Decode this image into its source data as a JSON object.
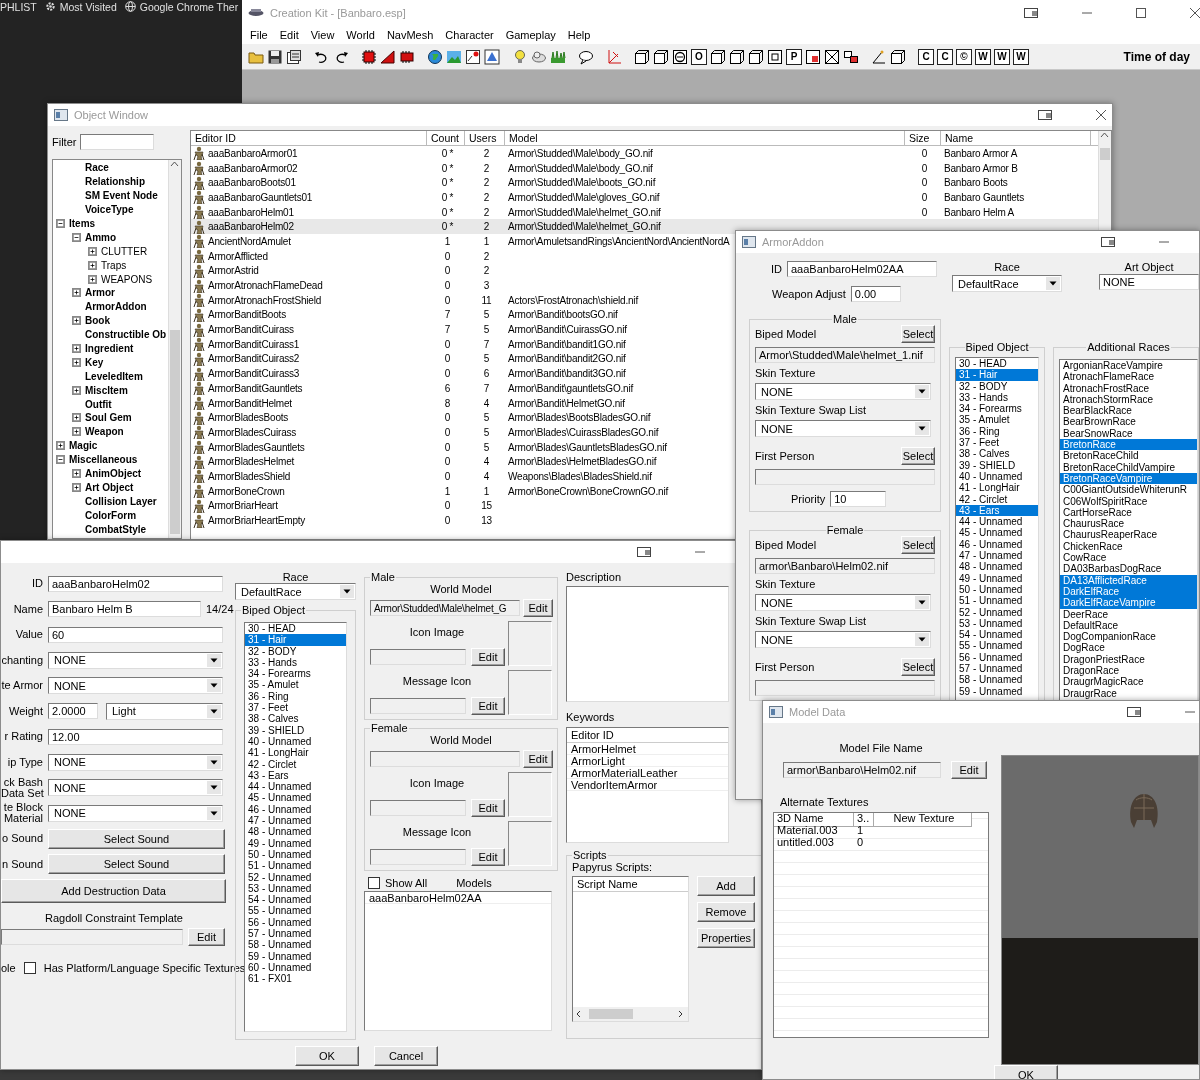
{
  "browser_bar": {
    "items": [
      {
        "label": "PHLIST",
        "kind": "plain"
      },
      {
        "label": "Most Visited",
        "kind": "gear"
      },
      {
        "label": "Google Chrome Ther",
        "kind": "globe"
      }
    ]
  },
  "main_window": {
    "title": "Creation Kit - [Banbaro.esp]",
    "menu": [
      "File",
      "Edit",
      "View",
      "World",
      "NavMesh",
      "Character",
      "Gameplay",
      "Help"
    ],
    "toolbar_glyphs": [
      "O",
      "P",
      "C",
      "C",
      "©",
      "W",
      "W",
      "W"
    ],
    "time_of_day": "Time of day"
  },
  "object_window": {
    "title": "Object Window",
    "filter_label": "Filter",
    "tree_continued": [
      {
        "label": "Race"
      },
      {
        "label": "Relationship"
      },
      {
        "label": "SM Event Node"
      },
      {
        "label": "VoiceType"
      }
    ],
    "tree": [
      {
        "label": "Items",
        "expandable": true,
        "expanded": true,
        "children": [
          {
            "label": "Ammo",
            "expandable": true,
            "expanded": true,
            "children": [
              {
                "label": "CLUTTER",
                "expandable": true,
                "expanded": false
              },
              {
                "label": "Traps",
                "expandable": true,
                "expanded": false
              },
              {
                "label": "WEAPONS",
                "expandable": true,
                "expanded": false
              }
            ]
          },
          {
            "label": "Armor",
            "expandable": true,
            "expanded": false
          },
          {
            "label": "ArmorAddon",
            "expandable": false,
            "expanded": false
          },
          {
            "label": "Book",
            "expandable": true,
            "expanded": false
          },
          {
            "label": "Constructible Ob",
            "expandable": false,
            "expanded": false
          },
          {
            "label": "Ingredient",
            "expandable": true,
            "expanded": false
          },
          {
            "label": "Key",
            "expandable": true,
            "expanded": false
          },
          {
            "label": "LeveledItem",
            "expandable": false,
            "expanded": false
          },
          {
            "label": "MiscItem",
            "expandable": true,
            "expanded": false
          },
          {
            "label": "Outfit",
            "expandable": false,
            "expanded": false
          },
          {
            "label": "Soul Gem",
            "expandable": true,
            "expanded": false
          },
          {
            "label": "Weapon",
            "expandable": true,
            "expanded": false
          }
        ]
      },
      {
        "label": "Magic",
        "expandable": true,
        "expanded": false
      },
      {
        "label": "Miscellaneous",
        "expandable": true,
        "expanded": true,
        "children": [
          {
            "label": "AnimObject",
            "expandable": true,
            "expanded": false
          },
          {
            "label": "Art Object",
            "expandable": true,
            "expanded": false
          },
          {
            "label": "Collision Layer",
            "expandable": false,
            "expanded": false
          },
          {
            "label": "ColorForm",
            "expandable": false,
            "expanded": false
          },
          {
            "label": "CombatStyle",
            "expandable": false,
            "expanded": false
          }
        ]
      }
    ],
    "table": {
      "columns": [
        "Editor ID",
        "Count",
        "Users",
        "Model",
        "Size",
        "Name"
      ],
      "rows": [
        {
          "editor_id": "aaaBanbaroArmor01",
          "count": "0 *",
          "users": "2",
          "model": "Armor\\Studded\\Male\\body_GO.nif",
          "size": "0",
          "name": "Banbaro Armor A",
          "selected": false
        },
        {
          "editor_id": "aaaBanbaroArmor02",
          "count": "0 *",
          "users": "2",
          "model": "Armor\\Studded\\Male\\body_GO.nif",
          "size": "0",
          "name": "Banbaro Armor B",
          "selected": false
        },
        {
          "editor_id": "aaaBanbaroBoots01",
          "count": "0 *",
          "users": "2",
          "model": "Armor\\Studded\\Male\\boots_GO.nif",
          "size": "0",
          "name": "Banbaro Boots",
          "selected": false
        },
        {
          "editor_id": "aaaBanbaroGauntlets01",
          "count": "0 *",
          "users": "2",
          "model": "Armor\\Studded\\Male\\gloves_GO.nif",
          "size": "0",
          "name": "Banbaro Gauntlets",
          "selected": false
        },
        {
          "editor_id": "aaaBanbaroHelm01",
          "count": "0 *",
          "users": "2",
          "model": "Armor\\Studded\\Male\\helmet_GO.nif",
          "size": "0",
          "name": "Banbaro Helm A",
          "selected": false
        },
        {
          "editor_id": "aaaBanbaroHelm02",
          "count": "0 *",
          "users": "2",
          "model": "Armor\\Studded\\Male\\helmet_GO.nif",
          "selected": true
        },
        {
          "editor_id": "AncientNordAmulet",
          "count": "1",
          "users": "1",
          "model": "Armor\\AmuletsandRings\\AncientNord\\AncientNordA",
          "selected": false
        },
        {
          "editor_id": "ArmorAfflicted",
          "count": "0",
          "users": "2",
          "selected": false
        },
        {
          "editor_id": "ArmorAstrid",
          "count": "0",
          "users": "2",
          "selected": false
        },
        {
          "editor_id": "ArmorAtronachFlameDead",
          "count": "0",
          "users": "3",
          "selected": false
        },
        {
          "editor_id": "ArmorAtronachFrostShield",
          "count": "0",
          "users": "11",
          "model": "Actors\\FrostAtronach\\shield.nif",
          "selected": false
        },
        {
          "editor_id": "ArmorBanditBoots",
          "count": "7",
          "users": "5",
          "model": "Armor\\Bandit\\bootsGO.nif",
          "selected": false
        },
        {
          "editor_id": "ArmorBanditCuirass",
          "count": "7",
          "users": "5",
          "model": "Armor\\Bandit\\CuirassGO.nif",
          "selected": false
        },
        {
          "editor_id": "ArmorBanditCuirass1",
          "count": "0",
          "users": "7",
          "model": "Armor\\Bandit\\bandit1GO.nif",
          "selected": false
        },
        {
          "editor_id": "ArmorBanditCuirass2",
          "count": "0",
          "users": "5",
          "model": "Armor\\Bandit\\bandit2GO.nif",
          "selected": false
        },
        {
          "editor_id": "ArmorBanditCuirass3",
          "count": "0",
          "users": "6",
          "model": "Armor\\Bandit\\bandit3GO.nif",
          "selected": false
        },
        {
          "editor_id": "ArmorBanditGauntlets",
          "count": "6",
          "users": "7",
          "model": "Armor\\Bandit\\gauntletsGO.nif",
          "selected": false
        },
        {
          "editor_id": "ArmorBanditHelmet",
          "count": "8",
          "users": "4",
          "model": "Armor\\Bandit\\HelmetGO.nif",
          "selected": false
        },
        {
          "editor_id": "ArmorBladesBoots",
          "count": "0",
          "users": "5",
          "model": "Armor\\Blades\\BootsBladesGO.nif",
          "selected": false
        },
        {
          "editor_id": "ArmorBladesCuirass",
          "count": "0",
          "users": "5",
          "model": "Armor\\Blades\\CuirassBladesGO.nif",
          "selected": false
        },
        {
          "editor_id": "ArmorBladesGauntlets",
          "count": "0",
          "users": "5",
          "model": "Armor\\Blades\\GauntletsBladesGO.nif",
          "selected": false
        },
        {
          "editor_id": "ArmorBladesHelmet",
          "count": "0",
          "users": "4",
          "model": "Armor\\Blades\\HelmetBladesGO.nif",
          "selected": false
        },
        {
          "editor_id": "ArmorBladesShield",
          "count": "0",
          "users": "4",
          "model": "Weapons\\Blades\\BladesShield.nif",
          "selected": false
        },
        {
          "editor_id": "ArmorBoneCrown",
          "count": "1",
          "users": "1",
          "model": "Armor\\BoneCrown\\BoneCrownGO.nif",
          "selected": false
        },
        {
          "editor_id": "ArmorBriarHeart",
          "count": "0",
          "users": "15",
          "selected": false
        },
        {
          "editor_id": "ArmorBriarHeartEmpty",
          "count": "0",
          "users": "13",
          "selected": false
        }
      ]
    }
  },
  "armor_window": {
    "fields": [
      {
        "label": "ID",
        "kind": "text",
        "value": "aaaBanbaroHelm02"
      },
      {
        "label": "Name",
        "kind": "text",
        "value": "Banbaro Helm B",
        "counter": "14/24"
      },
      {
        "label": "Value",
        "kind": "text",
        "value": "60"
      },
      {
        "label": "chanting",
        "kind": "dropdown",
        "value": "NONE"
      },
      {
        "label": "te Armor",
        "kind": "dropdown",
        "value": "NONE"
      },
      {
        "label": "Weight",
        "kind": "weight",
        "value": "2.0000",
        "option": "Light"
      },
      {
        "label": "r Rating",
        "kind": "text",
        "value": "12.00"
      },
      {
        "label": "ip Type",
        "kind": "dropdown",
        "value": "NONE"
      },
      {
        "label": "ck Bash\nData Set",
        "kind": "dropdown",
        "value": "NONE"
      },
      {
        "label": "te Block\nMaterial",
        "kind": "dropdown",
        "value": "NONE"
      },
      {
        "label": "o Sound",
        "kind": "button",
        "value": "Select Sound"
      },
      {
        "label": "n Sound",
        "kind": "button",
        "value": "Select Sound"
      }
    ],
    "destruction_button": "Add Destruction Data",
    "ragdoll_label": "Ragdoll Constraint Template",
    "ragdoll_edit": "Edit",
    "cut_label": "ole",
    "platform_checkbox": {
      "label": "Has Platform/Language Specific Textures",
      "checked": false
    },
    "race_label": "Race",
    "race": "DefaultRace",
    "biped_title": "Biped Object",
    "biped_items": [
      {
        "label": "30 - HEAD",
        "selected": false
      },
      {
        "label": "31 - Hair",
        "selected": true
      },
      {
        "label": "32 - BODY",
        "selected": false
      },
      {
        "label": "33 - Hands",
        "selected": false
      },
      {
        "label": "34 - Forearms",
        "selected": false
      },
      {
        "label": "35 - Amulet",
        "selected": false
      },
      {
        "label": "36 - Ring",
        "selected": false
      },
      {
        "label": "37 - Feet",
        "selected": false
      },
      {
        "label": "38 - Calves",
        "selected": false
      },
      {
        "label": "39 - SHIELD",
        "selected": false
      },
      {
        "label": "40 - Unnamed",
        "selected": false
      },
      {
        "label": "41 - LongHair",
        "selected": false
      },
      {
        "label": "42 - Circlet",
        "selected": false
      },
      {
        "label": "43 - Ears",
        "selected": false
      },
      {
        "label": "44 - Unnamed",
        "selected": false
      },
      {
        "label": "45 - Unnamed",
        "selected": false
      },
      {
        "label": "46 - Unnamed",
        "selected": false
      },
      {
        "label": "47 - Unnamed",
        "selected": false
      },
      {
        "label": "48 - Unnamed",
        "selected": false
      },
      {
        "label": "49 - Unnamed",
        "selected": false
      },
      {
        "label": "50 - Unnamed",
        "selected": false
      },
      {
        "label": "51 - Unnamed",
        "selected": false
      },
      {
        "label": "52 - Unnamed",
        "selected": false
      },
      {
        "label": "53 - Unnamed",
        "selected": false
      },
      {
        "label": "54 - Unnamed",
        "selected": false
      },
      {
        "label": "55 - Unnamed",
        "selected": false
      },
      {
        "label": "56 - Unnamed",
        "selected": false
      },
      {
        "label": "57 - Unnamed",
        "selected": false
      },
      {
        "label": "58 - Unnamed",
        "selected": false
      },
      {
        "label": "59 - Unnamed",
        "selected": false
      },
      {
        "label": "60 - Unnamed",
        "selected": false
      },
      {
        "label": "61 - FX01",
        "selected": false
      }
    ],
    "groups": [
      {
        "title": "Male",
        "world_model_label": "World Model",
        "world_model": "Armor\\Studded\\Male\\helmet_G",
        "world_model_edit": "Edit",
        "icon_label": "Icon Image",
        "icon_edit": "Edit",
        "message_label": "Message Icon",
        "message_edit": "Edit"
      },
      {
        "title": "Female",
        "world_model_label": "World Model",
        "world_model_edit": "Edit",
        "icon_label": "Icon Image",
        "icon_edit": "Edit",
        "message_label": "Message Icon",
        "message_edit": "Edit"
      }
    ],
    "show_all": {
      "label": "Show All",
      "checked": false
    },
    "models_label": "Models",
    "models": [
      "aaaBanbaroHelm02AA"
    ],
    "description_label": "Description",
    "keywords_label": "Keywords",
    "keywords_column": "Editor ID",
    "keywords": [
      "ArmorHelmet",
      "ArmorLight",
      "ArmorMaterialLeather",
      "VendorItemArmor"
    ],
    "scripts": {
      "title": "Scripts",
      "subtitle": "Papyrus Scripts:",
      "column": "Script Name",
      "buttons": [
        "Add",
        "Remove",
        "Properties"
      ]
    },
    "buttons": [
      "OK",
      "Cancel"
    ]
  },
  "armor_addon_window": {
    "title": "ArmorAddon",
    "id_label": "ID",
    "id": "aaaBanbaroHelm02AA",
    "weapon_adjust_label": "Weapon Adjust",
    "weapon_adjust": "0.00",
    "race_label": "Race",
    "race": "DefaultRace",
    "art_object_label": "Art Object",
    "art_object": "NONE",
    "groups": [
      {
        "title": "Male",
        "biped_model_label": "Biped Model",
        "biped_select": "Select",
        "biped_model": "Armor\\Studded\\Male\\helmet_1.nif",
        "skin_label": "Skin Texture",
        "skin": "NONE",
        "swap_label": "Skin Texture Swap List",
        "swap": "NONE",
        "first_person_label": "First Person",
        "first_person_select": "Select",
        "priority_label": "Priority",
        "priority": "10"
      },
      {
        "title": "Female",
        "biped_model_label": "Biped Model",
        "biped_select": "Select",
        "biped_model": "armor\\Banbaro\\Helm02.nif",
        "skin_label": "Skin Texture",
        "skin": "NONE",
        "swap_label": "Skin Texture Swap List",
        "swap": "NONE",
        "first_person_label": "First Person",
        "first_person_select": "Select"
      }
    ],
    "biped_title": "Biped Object",
    "biped_items": [
      {
        "label": "30 - HEAD",
        "selected": false
      },
      {
        "label": "31 - Hair",
        "selected": true
      },
      {
        "label": "32 - BODY",
        "selected": false
      },
      {
        "label": "33 - Hands",
        "selected": false
      },
      {
        "label": "34 - Forearms",
        "selected": false
      },
      {
        "label": "35 - Amulet",
        "selected": false
      },
      {
        "label": "36 - Ring",
        "selected": false
      },
      {
        "label": "37 - Feet",
        "selected": false
      },
      {
        "label": "38 - Calves",
        "selected": false
      },
      {
        "label": "39 - SHIELD",
        "selected": false
      },
      {
        "label": "40 - Unnamed",
        "selected": false
      },
      {
        "label": "41 - LongHair",
        "selected": false
      },
      {
        "label": "42 - Circlet",
        "selected": false
      },
      {
        "label": "43 - Ears",
        "selected": true
      },
      {
        "label": "44 - Unnamed",
        "selected": false
      },
      {
        "label": "45 - Unnamed",
        "selected": false
      },
      {
        "label": "46 - Unnamed",
        "selected": false
      },
      {
        "label": "47 - Unnamed",
        "selected": false
      },
      {
        "label": "48 - Unnamed",
        "selected": false
      },
      {
        "label": "49 - Unnamed",
        "selected": false
      },
      {
        "label": "50 - Unnamed",
        "selected": false
      },
      {
        "label": "51 - Unnamed",
        "selected": false
      },
      {
        "label": "52 - Unnamed",
        "selected": false
      },
      {
        "label": "53 - Unnamed",
        "selected": false
      },
      {
        "label": "54 - Unnamed",
        "selected": false
      },
      {
        "label": "55 - Unnamed",
        "selected": false
      },
      {
        "label": "56 - Unnamed",
        "selected": false
      },
      {
        "label": "57 - Unnamed",
        "selected": false
      },
      {
        "label": "58 - Unnamed",
        "selected": false
      },
      {
        "label": "59 - Unnamed",
        "selected": false
      }
    ],
    "races_title": "Additional Races",
    "races": [
      {
        "label": "ArgonianRaceVampire",
        "selected": false
      },
      {
        "label": "AtronachFlameRace",
        "selected": false
      },
      {
        "label": "AtronachFrostRace",
        "selected": false
      },
      {
        "label": "AtronachStormRace",
        "selected": false
      },
      {
        "label": "BearBlackRace",
        "selected": false
      },
      {
        "label": "BearBrownRace",
        "selected": false
      },
      {
        "label": "BearSnowRace",
        "selected": false
      },
      {
        "label": "BretonRace",
        "selected": true
      },
      {
        "label": "BretonRaceChild",
        "selected": false
      },
      {
        "label": "BretonRaceChildVampire",
        "selected": false
      },
      {
        "label": "BretonRaceVampire",
        "selected": true
      },
      {
        "label": "C00GiantOutsideWhiterunR",
        "selected": false
      },
      {
        "label": "C06WolfSpiritRace",
        "selected": false
      },
      {
        "label": "CartHorseRace",
        "selected": false
      },
      {
        "label": "ChaurusRace",
        "selected": false
      },
      {
        "label": "ChaurusReaperRace",
        "selected": false
      },
      {
        "label": "ChickenRace",
        "selected": false
      },
      {
        "label": "CowRace",
        "selected": false
      },
      {
        "label": "DA03BarbasDogRace",
        "selected": false
      },
      {
        "label": "DA13AfflictedRace",
        "selected": true
      },
      {
        "label": "DarkElfRace",
        "selected": true
      },
      {
        "label": "DarkElfRaceVampire",
        "selected": true
      },
      {
        "label": "DeerRace",
        "selected": false
      },
      {
        "label": "DefaultRace",
        "selected": false
      },
      {
        "label": "DogCompanionRace",
        "selected": false
      },
      {
        "label": "DogRace",
        "selected": false
      },
      {
        "label": "DragonPriestRace",
        "selected": false
      },
      {
        "label": "DragonRace",
        "selected": false
      },
      {
        "label": "DraugrMagicRace",
        "selected": false
      },
      {
        "label": "DraugrRace",
        "selected": false
      }
    ]
  },
  "model_data_window": {
    "title": "Model Data",
    "file_label": "Model File Name",
    "file": "armor\\Banbaro\\Helm02.nif",
    "edit": "Edit",
    "alt_label": "Alternate Textures",
    "columns": [
      "3D Name",
      "3..",
      "New Texture"
    ],
    "rows": [
      {
        "name": "Material.003",
        "index": "1"
      },
      {
        "name": "untitled.003",
        "index": "0"
      }
    ],
    "ok": "OK"
  }
}
